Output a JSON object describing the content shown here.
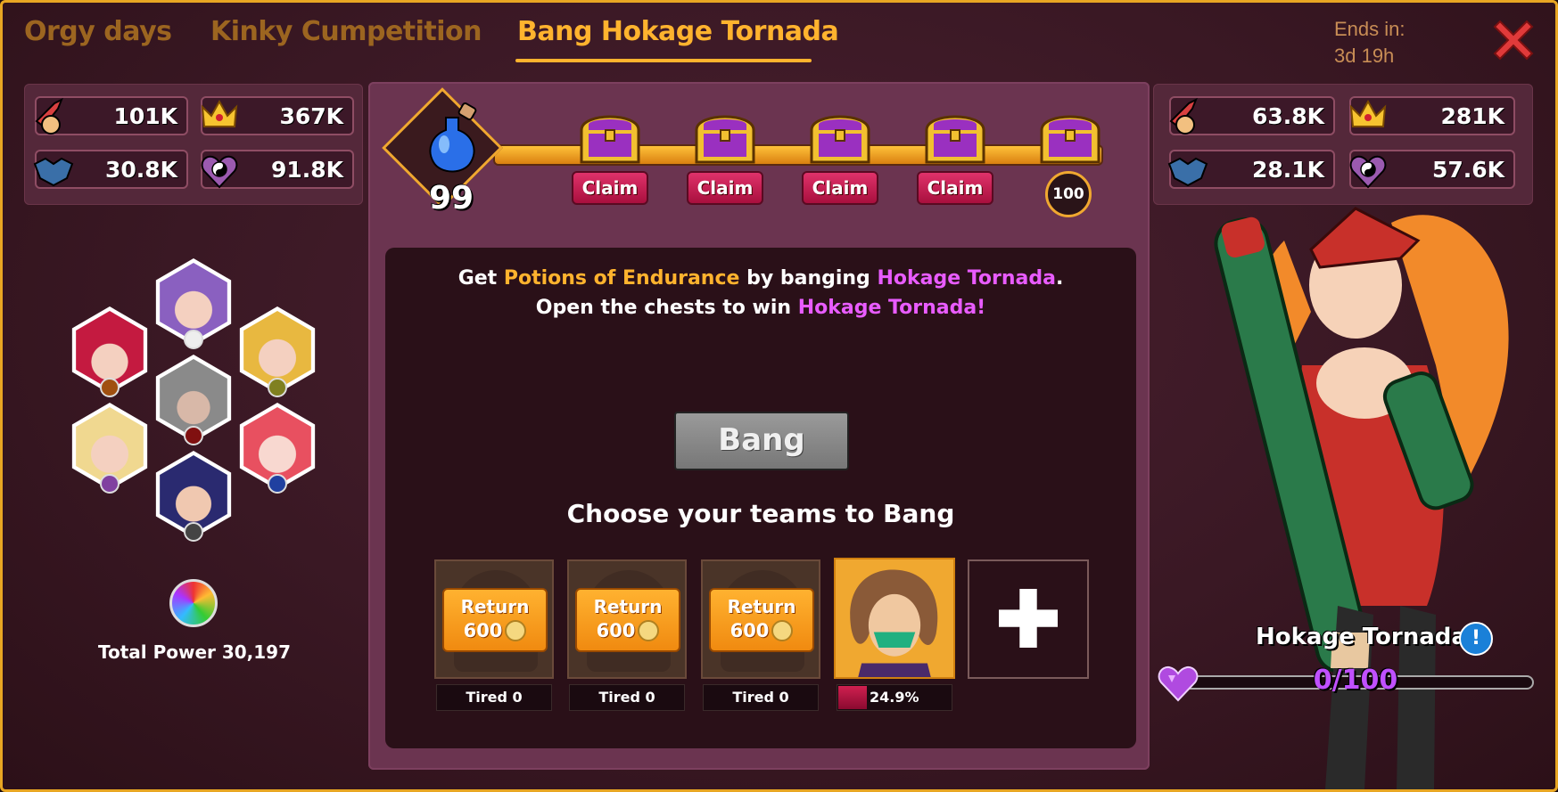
{
  "tabs": [
    {
      "label": "Orgy days",
      "active": false
    },
    {
      "label": "Kinky Cumpetition",
      "active": false
    },
    {
      "label": "Bang Hokage Tornada",
      "active": true
    }
  ],
  "ends": {
    "label": "Ends in:",
    "value": "3d 19h"
  },
  "player_stats": {
    "hardcore": "101K",
    "ego": "367K",
    "defense": "30.8K",
    "harmony": "91.8K"
  },
  "boss_stats": {
    "hardcore": "63.8K",
    "ego": "281K",
    "defense": "28.1K",
    "harmony": "57.6K"
  },
  "team": {
    "total_power_label": "Total Power 30,197"
  },
  "progress": {
    "potions": "99",
    "claim_label": "Claim",
    "claims": [
      "Claim",
      "Claim",
      "Claim",
      "Claim"
    ],
    "final_threshold": "100"
  },
  "description": {
    "p1": "Get ",
    "potion_name": "Potions of Endurance",
    "p2": " by banging ",
    "boss_name_1": "Hokage Tornada",
    "p3": ". Open the chests to win ",
    "boss_name_2": "Hokage Tornada!"
  },
  "bang_button": "Bang",
  "choose_label": "Choose your teams to Bang",
  "team_slots": [
    {
      "return_label": "Return",
      "cost": "600",
      "tired": "Tired 0"
    },
    {
      "return_label": "Return",
      "cost": "600",
      "tired": "Tired 0"
    },
    {
      "return_label": "Return",
      "cost": "600",
      "tired": "Tired 0"
    }
  ],
  "active_team": {
    "hp_percent": "24.9%",
    "hp_fraction": 0.249
  },
  "boss": {
    "name": "Hokage Tornada",
    "affection": "0/100",
    "info_icon": "!"
  },
  "colors": {
    "accent": "#ffb32e",
    "claim": "#c41a50",
    "highlight_pink": "#e95cff"
  }
}
